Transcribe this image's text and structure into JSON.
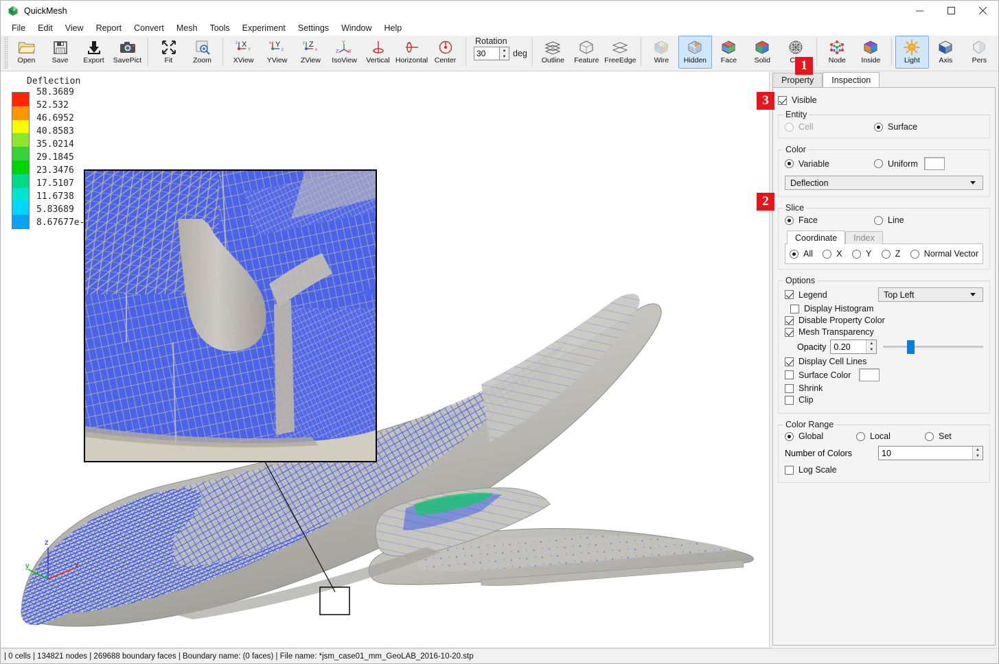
{
  "window": {
    "title": "QuickMesh",
    "icon": "app-icon",
    "minimize": "—",
    "maximize": "□",
    "close": "✕"
  },
  "menu": [
    "File",
    "Edit",
    "View",
    "Report",
    "Convert",
    "Mesh",
    "Tools",
    "Experiment",
    "Settings",
    "Window",
    "Help"
  ],
  "toolbar": {
    "groups": [
      {
        "items": [
          {
            "label": "Open",
            "icon": "folder-open-icon",
            "active": false
          },
          {
            "label": "Save",
            "icon": "floppy-disk-icon",
            "active": false
          },
          {
            "label": "Export",
            "icon": "export-download-icon",
            "active": false
          },
          {
            "label": "SavePict",
            "icon": "camera-icon",
            "active": false
          }
        ]
      },
      {
        "items": [
          {
            "label": "Fit",
            "icon": "fit-arrows-icon",
            "active": false
          },
          {
            "label": "Zoom",
            "icon": "zoom-magnifier-icon",
            "active": false
          }
        ]
      },
      {
        "items": [
          {
            "label": "XView",
            "icon": "x-view-axis-icon",
            "active": false
          },
          {
            "label": "YView",
            "icon": "y-view-axis-icon",
            "active": false
          },
          {
            "label": "ZView",
            "icon": "z-view-axis-icon",
            "active": false
          },
          {
            "label": "IsoView",
            "icon": "iso-view-axis-icon",
            "active": false
          },
          {
            "label": "Vertical",
            "icon": "rotate-vertical-icon",
            "active": false
          },
          {
            "label": "Horizontal",
            "icon": "rotate-horizontal-icon",
            "active": false
          },
          {
            "label": "Center",
            "icon": "rotate-center-icon",
            "active": false
          }
        ]
      }
    ],
    "rotation": {
      "label": "Rotation",
      "value": "30",
      "unit": "deg"
    },
    "view_modes": [
      {
        "label": "Outline",
        "icon": "outline-layers-icon",
        "active": false
      },
      {
        "label": "Feature",
        "icon": "feature-cube-icon",
        "active": false
      },
      {
        "label": "FreeEdge",
        "icon": "freeedge-sheets-icon",
        "active": false
      }
    ],
    "render_modes": [
      {
        "label": "Wire",
        "icon": "wireframe-cube-icon",
        "active": false
      },
      {
        "label": "Hidden",
        "icon": "hidden-line-cube-icon",
        "active": true
      },
      {
        "label": "Face",
        "icon": "face-cube-icon",
        "active": false
      },
      {
        "label": "Solid",
        "icon": "solid-cube-icon",
        "active": false
      },
      {
        "label": "Cell",
        "icon": "cell-mesh-icon",
        "active": false
      }
    ],
    "entity_modes": [
      {
        "label": "Node",
        "icon": "node-points-icon",
        "active": false
      },
      {
        "label": "Inside",
        "icon": "inside-cube-icon",
        "active": false
      }
    ],
    "display_modes": [
      {
        "label": "Light",
        "icon": "light-sun-icon",
        "active": true
      },
      {
        "label": "Axis",
        "icon": "axis-cube-icon",
        "active": false
      },
      {
        "label": "Pers",
        "icon": "perspective-shape-icon",
        "active": false
      }
    ]
  },
  "viewport": {
    "legend": {
      "title": "Deflection",
      "labels": [
        "58.3689",
        "52.532",
        "46.6952",
        "40.8583",
        "35.0214",
        "29.1845",
        "23.3476",
        "17.5107",
        "11.6738",
        "5.83689",
        "8.67677e-"
      ],
      "colors": [
        "#ff2600",
        "#ff9500",
        "#fbfb00",
        "#8fe62b",
        "#39d13b",
        "#00d400",
        "#00d98a",
        "#00e5d2",
        "#00d6ff",
        "#0aa3f5",
        "#1a35ff"
      ]
    },
    "axis_triad": {
      "x": "x",
      "y": "y",
      "z": "z"
    },
    "inset_label": "zoom-detail-inset"
  },
  "panel": {
    "tabs": [
      {
        "label": "Property",
        "selected": false
      },
      {
        "label": "Inspection",
        "selected": true
      }
    ],
    "visible": {
      "label": "Visible",
      "checked": true
    },
    "entity": {
      "title": "Entity",
      "options": [
        {
          "label": "Cell",
          "selected": false,
          "disabled": true
        },
        {
          "label": "Surface",
          "selected": true,
          "disabled": false
        }
      ]
    },
    "color": {
      "title": "Color",
      "options": [
        {
          "label": "Variable",
          "selected": true
        },
        {
          "label": "Uniform",
          "selected": false
        }
      ],
      "uniform_swatch": "#fdfdfd",
      "variable_value": "Deflection"
    },
    "slice": {
      "title": "Slice",
      "mode": [
        {
          "label": "Face",
          "selected": true
        },
        {
          "label": "Line",
          "selected": false
        }
      ],
      "subtabs": [
        {
          "label": "Coordinate",
          "selected": true
        },
        {
          "label": "Index",
          "selected": false,
          "disabled": true
        }
      ],
      "axes": [
        {
          "label": "All",
          "selected": true
        },
        {
          "label": "X",
          "selected": false
        },
        {
          "label": "Y",
          "selected": false
        },
        {
          "label": "Z",
          "selected": false
        },
        {
          "label": "Normal Vector",
          "selected": false
        }
      ]
    },
    "options": {
      "title": "Options",
      "legend": {
        "label": "Legend",
        "checked": true,
        "position": "Top Left"
      },
      "histogram": {
        "label": "Display Histogram",
        "checked": false
      },
      "disable_property_color": {
        "label": "Disable Property Color",
        "checked": true
      },
      "mesh_transparency": {
        "label": "Mesh Transparency",
        "checked": true
      },
      "opacity": {
        "label": "Opacity",
        "value": "0.20",
        "slider_percent": 24
      },
      "display_cell_lines": {
        "label": "Display Cell Lines",
        "checked": true
      },
      "surface_color": {
        "label": "Surface Color",
        "checked": false,
        "swatch": "#fdfdfd"
      },
      "shrink": {
        "label": "Shrink",
        "checked": false
      },
      "clip": {
        "label": "Clip",
        "checked": false
      }
    },
    "color_range": {
      "title": "Color Range",
      "modes": [
        {
          "label": "Global",
          "selected": true
        },
        {
          "label": "Local",
          "selected": false
        },
        {
          "label": "Set",
          "selected": false
        }
      ],
      "number_of_colors": {
        "label": "Number of Colors",
        "value": "10"
      },
      "log_scale": {
        "label": "Log Scale",
        "checked": false
      }
    }
  },
  "badges": [
    {
      "number": "1",
      "target": "toolbar-axis-button"
    },
    {
      "number": "2",
      "target": "variable-combo"
    },
    {
      "number": "3",
      "target": "visible-checkbox"
    }
  ],
  "statusbar": {
    "text": "| 0 cells | 134821 nodes | 269688 boundary faces |  Boundary name:  (0 faces) | File name: *jsm_case01_mm_GeoLAB_2016-10-20.stp"
  }
}
